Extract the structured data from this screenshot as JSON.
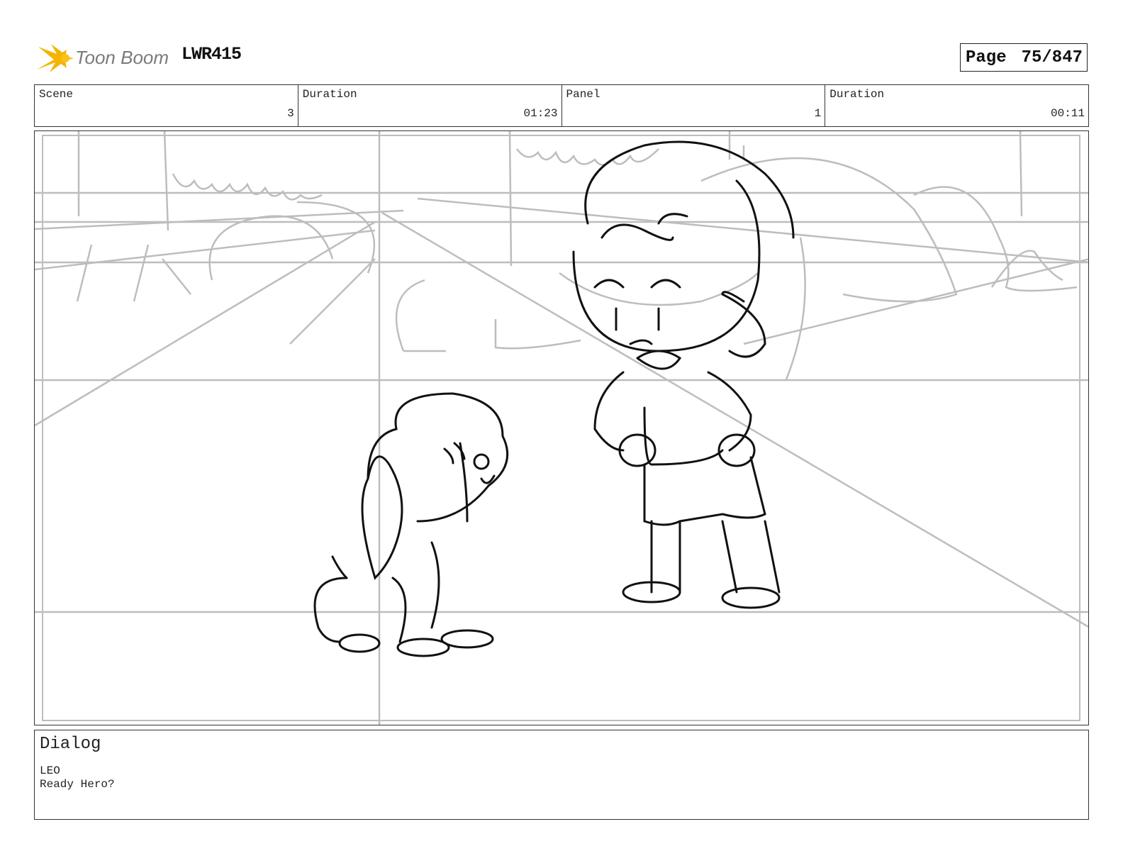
{
  "header": {
    "logo_text": "Toon Boom",
    "project_code": "LWR415",
    "page_label": "Page",
    "page_value": "75/847"
  },
  "info": {
    "scene_label": "Scene",
    "scene_value": "3",
    "scene_duration_label": "Duration",
    "scene_duration_value": "01:23",
    "panel_label": "Panel",
    "panel_value": "1",
    "panel_duration_label": "Duration",
    "panel_duration_value": "00:11"
  },
  "dialog": {
    "title": "Dialog",
    "speaker": "LEO",
    "line": "Ready Hero?"
  },
  "colors": {
    "logo_star": "#f5b400",
    "logo_text": "#7a7a7a",
    "sketch_light": "#bdbdbd",
    "sketch_dark": "#111111"
  }
}
